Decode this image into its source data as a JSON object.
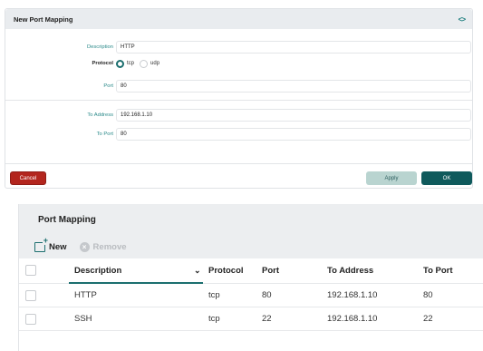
{
  "dialog": {
    "title": "New Port Mapping",
    "expand_icon": "<>",
    "description_label": "Description",
    "description_value": "HTTP",
    "protocol_label": "Protocol",
    "protocol_options": [
      "tcp",
      "udp"
    ],
    "protocol_selected": "tcp",
    "port_label": "Port",
    "port_value": "80",
    "to_address_label": "To Address",
    "to_address_value": "192.168.1.10",
    "to_port_label": "To Port",
    "to_port_value": "80",
    "cancel_label": "Cancel",
    "apply_label": "Apply",
    "ok_label": "OK"
  },
  "panel": {
    "title": "Port Mapping",
    "new_label": "New",
    "remove_label": "Remove",
    "columns": [
      "Description",
      "Protocol",
      "Port",
      "To Address",
      "To Port"
    ],
    "sort_icon": "chevron-down-icon",
    "rows": [
      {
        "description": "HTTP",
        "protocol": "tcp",
        "port": "80",
        "to_address": "192.168.1.10",
        "to_port": "80"
      },
      {
        "description": "SSH",
        "protocol": "tcp",
        "port": "22",
        "to_address": "192.168.1.10",
        "to_port": "22"
      }
    ]
  },
  "colors": {
    "accent": "#1c6f6f",
    "danger": "#b3261e",
    "ok": "#0f5a5c"
  }
}
